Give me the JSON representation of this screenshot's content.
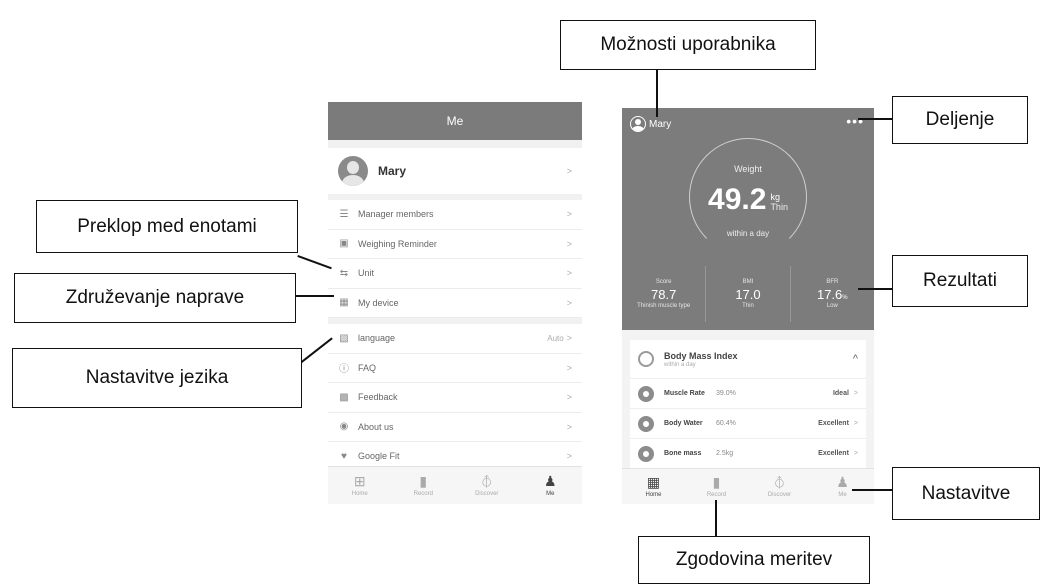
{
  "callouts": {
    "user_options": "Možnosti uporabnika",
    "sharing": "Deljenje",
    "unit_toggle": "Preklop med enotami",
    "device_pairing": "Združevanje naprave",
    "results": "Rezultati",
    "language_settings": "Nastavitve jezika",
    "settings": "Nastavitve",
    "measurement_history": "Zgodovina meritev"
  },
  "me_screen": {
    "title": "Me",
    "profile_name": "Mary",
    "chevron": ">",
    "group1": [
      {
        "label": "Manager members",
        "icon": "members-icon"
      },
      {
        "label": "Weighing Reminder",
        "icon": "reminder-icon"
      },
      {
        "label": "Unit",
        "icon": "unit-icon"
      },
      {
        "label": "My device",
        "icon": "device-icon"
      }
    ],
    "group2": [
      {
        "label": "language",
        "icon": "language-icon",
        "value": "Auto"
      },
      {
        "label": "FAQ",
        "icon": "faq-icon"
      },
      {
        "label": "Feedback",
        "icon": "feedback-icon"
      },
      {
        "label": "About us",
        "icon": "about-icon"
      },
      {
        "label": "Google Fit",
        "icon": "heart-icon"
      }
    ],
    "tabs": [
      {
        "label": "Home",
        "icon": "grid-icon"
      },
      {
        "label": "Record",
        "icon": "bar-chart-icon"
      },
      {
        "label": "Discover",
        "icon": "compass-icon"
      },
      {
        "label": "Me",
        "icon": "person-icon",
        "active": true
      }
    ]
  },
  "home_screen": {
    "user": "Mary",
    "more": "•••",
    "weight_label": "Weight",
    "weight_value": "49.2",
    "weight_unit": "kg",
    "weight_status": "Thin",
    "within": "within a day",
    "stats": [
      {
        "label": "Score",
        "value": "78.7",
        "unit": "",
        "sub": "Thinish muscle type"
      },
      {
        "label": "BMI",
        "value": "17.0",
        "unit": "",
        "sub": "Thin"
      },
      {
        "label": "BFR",
        "value": "17.6",
        "unit": "%",
        "sub": "Low"
      }
    ],
    "bmi_card": {
      "title": "Body Mass Index",
      "sub": "within a day",
      "toggle": "^"
    },
    "metrics": [
      {
        "name": "Muscle Rate",
        "value": "39.0%",
        "status": "Ideal",
        "icon": "muscle-icon"
      },
      {
        "name": "Body Water",
        "value": "60.4%",
        "status": "Excellent",
        "icon": "water-icon"
      },
      {
        "name": "Bone mass",
        "value": "2.5kg",
        "status": "Excellent",
        "icon": "bone-icon"
      }
    ],
    "tabs": [
      {
        "label": "Home",
        "icon": "grid-icon",
        "active": true
      },
      {
        "label": "Record",
        "icon": "bar-chart-icon"
      },
      {
        "label": "Discover",
        "icon": "compass-icon"
      },
      {
        "label": "Me",
        "icon": "person-icon"
      }
    ]
  }
}
